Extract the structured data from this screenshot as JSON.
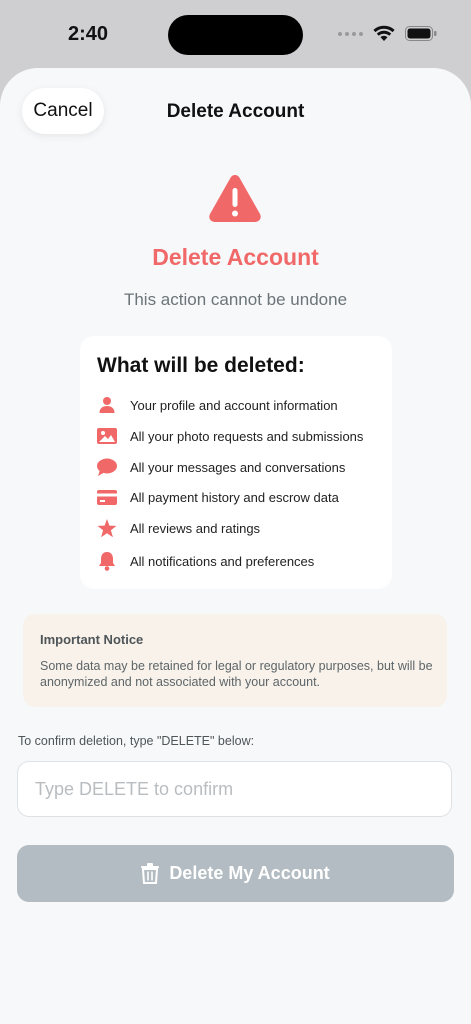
{
  "status_bar": {
    "time": "2:40"
  },
  "header": {
    "cancel_label": "Cancel",
    "title": "Delete Account"
  },
  "hero": {
    "icon": "warning-triangle-icon",
    "title": "Delete Account",
    "subtitle": "This action cannot be undone"
  },
  "deletion_card": {
    "title": "What will be deleted:",
    "items": [
      {
        "icon": "person-icon",
        "label": "Your profile and account information"
      },
      {
        "icon": "photo-icon",
        "label": "All your photo requests and submissions"
      },
      {
        "icon": "chat-bubble-icon",
        "label": "All your messages and conversations"
      },
      {
        "icon": "credit-card-icon",
        "label": "All payment history and escrow data"
      },
      {
        "icon": "star-icon",
        "label": "All reviews and ratings"
      },
      {
        "icon": "bell-icon",
        "label": "All notifications and preferences"
      }
    ]
  },
  "notice": {
    "title": "Important Notice",
    "body": "Some data may be retained for legal or regulatory purposes, but will be anonymized and not associated with your account."
  },
  "confirm": {
    "label": "To confirm deletion, type \"DELETE\" below:",
    "value": "",
    "placeholder": "Type DELETE to confirm"
  },
  "delete_button": {
    "label": "Delete My Account",
    "icon": "trash-icon"
  },
  "colors": {
    "accent_red": "#f06868",
    "disabled_button": "#b3bcc2",
    "notice_bg": "#f8f2ea",
    "sheet_bg": "#f7f8fa"
  }
}
